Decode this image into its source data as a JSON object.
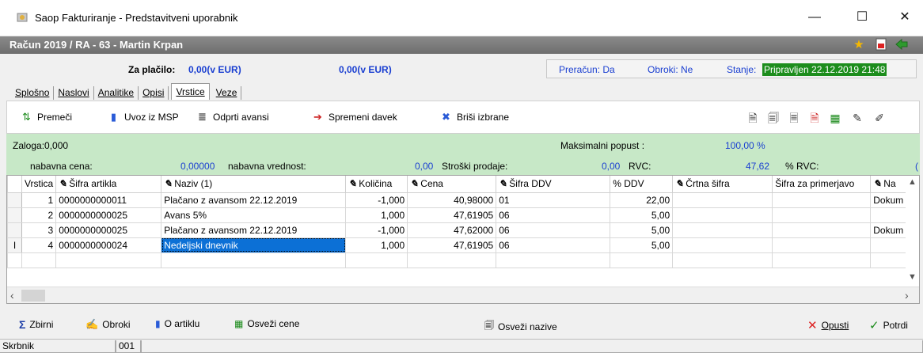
{
  "window": {
    "title": "Saop Fakturiranje - Predstavitveni uporabnik",
    "minimize": "—",
    "maximize": "☐",
    "close": "✕"
  },
  "doc": {
    "title": "Račun  2019 / RA - 63 - Martin Krpan",
    "icons": [
      "star-icon",
      "pdf-icon",
      "exit-icon"
    ]
  },
  "summary": {
    "za_placilo_label": "Za plačilo:",
    "za_placilo_value": "0,00(v EUR)",
    "second_value": "0,00(v EUR)",
    "preracun": "Preračun: Da",
    "obroki": "Obroki: Ne",
    "stanje_label": "Stanje:",
    "stanje_value": "Pripravljen 22.12.2019 21:48"
  },
  "tabs": [
    "Splošno",
    "Naslovi",
    "Analitike",
    "Opisi",
    "Vrstice",
    "Veze"
  ],
  "active_tab": "Vrstice",
  "toolbar": {
    "premeci": "Premeči",
    "uvoz": "Uvoz iz MSP",
    "odprti": "Odprti avansi",
    "spremeni": "Spremeni davek",
    "brisi": "Briši izbrane"
  },
  "info": {
    "zaloga": "Zaloga:0,000",
    "maks_label": "Maksimalni popust :",
    "maks_value": "100,00 %",
    "nabavna_cena_label": "nabavna cena:",
    "nabavna_cena_value": "0,00000",
    "nabavna_vrednost_label": "nabavna vrednost:",
    "nabavna_vrednost_value": "0,00",
    "stroski_label": "Stroški prodaje:",
    "stroski_value": "0,00",
    "rvc_label": "RVC:",
    "rvc_value": "47,62",
    "prvc_label": "% RVC:",
    "prvc_value": "("
  },
  "grid": {
    "columns": [
      "Vrstica",
      "Šifra artikla",
      "Naziv (1)",
      "Količina",
      "Cena",
      "Šifra DDV",
      "% DDV",
      "Črtna šifra",
      "Šifra za primerjavo",
      "Na"
    ],
    "rows": [
      {
        "vrstica": "1",
        "sifra": "0000000000011",
        "naziv": "Plačano z avansom 22.12.2019",
        "kolicina": "-1,000",
        "cena": "40,98000",
        "sifra_ddv": "01",
        "ddv": "22,00",
        "crtna": "",
        "primerjava": "",
        "na": "Dokum"
      },
      {
        "vrstica": "2",
        "sifra": "0000000000025",
        "naziv": "Avans 5%",
        "kolicina": "1,000",
        "cena": "47,61905",
        "sifra_ddv": "06",
        "ddv": "5,00",
        "crtna": "",
        "primerjava": "",
        "na": ""
      },
      {
        "vrstica": "3",
        "sifra": "0000000000025",
        "naziv": "Plačano z avansom 22.12.2019",
        "kolicina": "-1,000",
        "cena": "47,62000",
        "sifra_ddv": "06",
        "ddv": "5,00",
        "crtna": "",
        "primerjava": "",
        "na": "Dokum"
      },
      {
        "vrstica": "4",
        "sifra": "0000000000024",
        "naziv": "Nedeljski dnevnik",
        "kolicina": "1,000",
        "cena": "47,61905",
        "sifra_ddv": "06",
        "ddv": "5,00",
        "crtna": "",
        "primerjava": "",
        "na": ""
      }
    ]
  },
  "bottom": {
    "zbirni": "Zbirni",
    "obroki": "Obroki",
    "o_artiklu": "O artiklu",
    "osvezi_cene": "Osveži cene",
    "osvezi_nazive": "Osveži nazive",
    "opusti": "Opusti",
    "potrdi": "Potrdi"
  },
  "status": {
    "user": "Skrbnik",
    "code": "001"
  }
}
